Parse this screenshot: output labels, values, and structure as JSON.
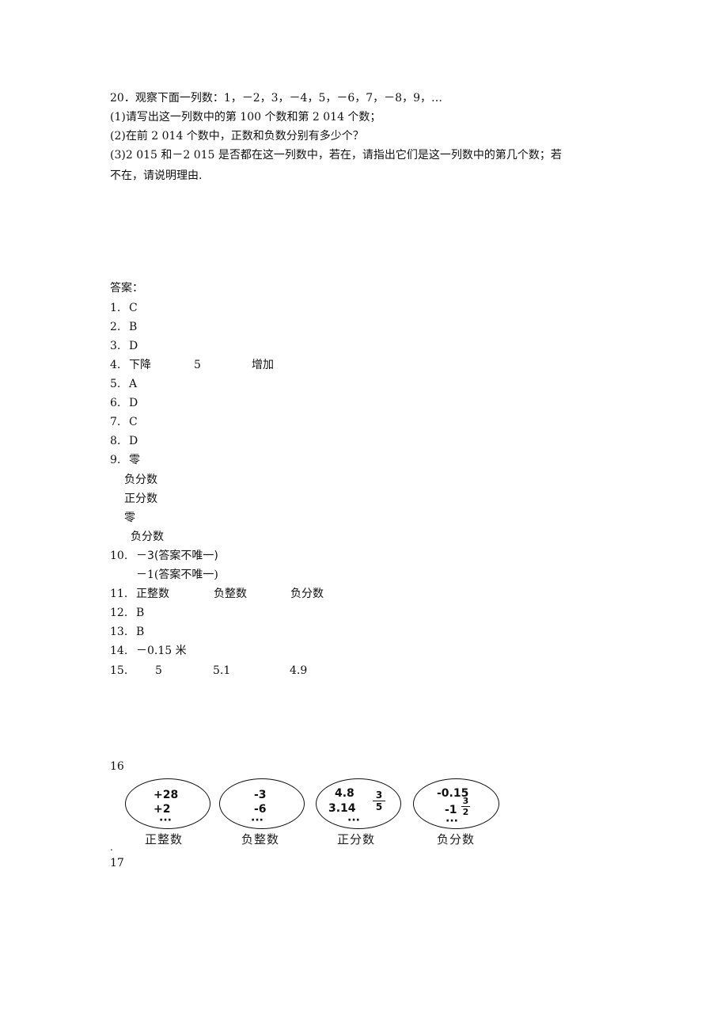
{
  "question": {
    "title": "20．观察下面一列数：1，－2，3，－4，5，－6，7，－8，9，…",
    "parts": [
      "(1)请写出这一列数中的第 100 个数和第 2 014 个数；",
      "(2)在前 2 014 个数中，正数和负数分别有多少个？",
      "(3)2 015 和－2 015 是否都在这一列数中，若在，请指出它们是这一列数中的第几个数；若",
      "不在，请说明理由."
    ]
  },
  "answers": {
    "heading": "答案：",
    "items": [
      {
        "num": "1.",
        "text": "C"
      },
      {
        "num": "2.",
        "text": "B"
      },
      {
        "num": "3.",
        "text": "D"
      },
      {
        "num": "4.",
        "cols": [
          "下降",
          "5",
          "增加"
        ]
      },
      {
        "num": "5.",
        "text": "A"
      },
      {
        "num": "6.",
        "text": "D"
      },
      {
        "num": "7.",
        "text": "C"
      },
      {
        "num": "8.",
        "text": "D"
      },
      {
        "num": "9.",
        "text": "零",
        "sub": [
          "负分数",
          "正分数",
          "零",
          "负分数"
        ]
      },
      {
        "num": "10.",
        "text": "－3(答案不唯一)",
        "sub": [
          "－1(答案不唯一)"
        ]
      },
      {
        "num": "11.",
        "cols": [
          "正整数",
          "负整数",
          "负分数"
        ]
      },
      {
        "num": "12.",
        "text": "B"
      },
      {
        "num": "13.",
        "text": "B"
      },
      {
        "num": "14.",
        "text": "－0.15 米"
      },
      {
        "num": "15.",
        "cols": [
          "5",
          "5.1",
          "4.9"
        ]
      }
    ],
    "q16": {
      "num": "16",
      "dot": ".",
      "ovals": [
        {
          "label": "正整数",
          "lines": [
            "+28",
            "+2",
            "···"
          ]
        },
        {
          "label": "负整数",
          "lines": [
            "-3",
            "-6",
            "···"
          ]
        },
        {
          "label": "正分数",
          "lines": [
            "4.8",
            "3.14",
            "···"
          ],
          "fraction": {
            "num": "3",
            "den": "5"
          }
        },
        {
          "label": "负分数",
          "lines": [
            "-0.15",
            "-1",
            "···"
          ],
          "fraction": {
            "num": "3",
            "den": "2"
          }
        }
      ]
    },
    "q17": {
      "num": "17"
    }
  }
}
